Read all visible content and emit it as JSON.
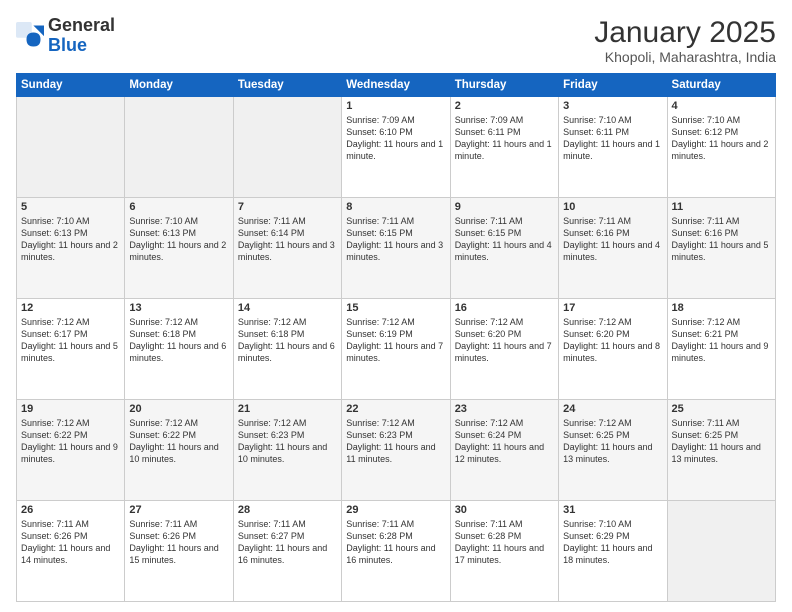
{
  "header": {
    "logo_general": "General",
    "logo_blue": "Blue",
    "month_title": "January 2025",
    "location": "Khopoli, Maharashtra, India"
  },
  "days_of_week": [
    "Sunday",
    "Monday",
    "Tuesday",
    "Wednesday",
    "Thursday",
    "Friday",
    "Saturday"
  ],
  "weeks": [
    [
      {
        "day": "",
        "sunrise": "",
        "sunset": "",
        "daylight": "",
        "empty": true
      },
      {
        "day": "",
        "sunrise": "",
        "sunset": "",
        "daylight": "",
        "empty": true
      },
      {
        "day": "",
        "sunrise": "",
        "sunset": "",
        "daylight": "",
        "empty": true
      },
      {
        "day": "1",
        "sunrise": "Sunrise: 7:09 AM",
        "sunset": "Sunset: 6:10 PM",
        "daylight": "Daylight: 11 hours and 1 minute."
      },
      {
        "day": "2",
        "sunrise": "Sunrise: 7:09 AM",
        "sunset": "Sunset: 6:11 PM",
        "daylight": "Daylight: 11 hours and 1 minute."
      },
      {
        "day": "3",
        "sunrise": "Sunrise: 7:10 AM",
        "sunset": "Sunset: 6:11 PM",
        "daylight": "Daylight: 11 hours and 1 minute."
      },
      {
        "day": "4",
        "sunrise": "Sunrise: 7:10 AM",
        "sunset": "Sunset: 6:12 PM",
        "daylight": "Daylight: 11 hours and 2 minutes."
      }
    ],
    [
      {
        "day": "5",
        "sunrise": "Sunrise: 7:10 AM",
        "sunset": "Sunset: 6:13 PM",
        "daylight": "Daylight: 11 hours and 2 minutes."
      },
      {
        "day": "6",
        "sunrise": "Sunrise: 7:10 AM",
        "sunset": "Sunset: 6:13 PM",
        "daylight": "Daylight: 11 hours and 2 minutes."
      },
      {
        "day": "7",
        "sunrise": "Sunrise: 7:11 AM",
        "sunset": "Sunset: 6:14 PM",
        "daylight": "Daylight: 11 hours and 3 minutes."
      },
      {
        "day": "8",
        "sunrise": "Sunrise: 7:11 AM",
        "sunset": "Sunset: 6:15 PM",
        "daylight": "Daylight: 11 hours and 3 minutes."
      },
      {
        "day": "9",
        "sunrise": "Sunrise: 7:11 AM",
        "sunset": "Sunset: 6:15 PM",
        "daylight": "Daylight: 11 hours and 4 minutes."
      },
      {
        "day": "10",
        "sunrise": "Sunrise: 7:11 AM",
        "sunset": "Sunset: 6:16 PM",
        "daylight": "Daylight: 11 hours and 4 minutes."
      },
      {
        "day": "11",
        "sunrise": "Sunrise: 7:11 AM",
        "sunset": "Sunset: 6:16 PM",
        "daylight": "Daylight: 11 hours and 5 minutes."
      }
    ],
    [
      {
        "day": "12",
        "sunrise": "Sunrise: 7:12 AM",
        "sunset": "Sunset: 6:17 PM",
        "daylight": "Daylight: 11 hours and 5 minutes."
      },
      {
        "day": "13",
        "sunrise": "Sunrise: 7:12 AM",
        "sunset": "Sunset: 6:18 PM",
        "daylight": "Daylight: 11 hours and 6 minutes."
      },
      {
        "day": "14",
        "sunrise": "Sunrise: 7:12 AM",
        "sunset": "Sunset: 6:18 PM",
        "daylight": "Daylight: 11 hours and 6 minutes."
      },
      {
        "day": "15",
        "sunrise": "Sunrise: 7:12 AM",
        "sunset": "Sunset: 6:19 PM",
        "daylight": "Daylight: 11 hours and 7 minutes."
      },
      {
        "day": "16",
        "sunrise": "Sunrise: 7:12 AM",
        "sunset": "Sunset: 6:20 PM",
        "daylight": "Daylight: 11 hours and 7 minutes."
      },
      {
        "day": "17",
        "sunrise": "Sunrise: 7:12 AM",
        "sunset": "Sunset: 6:20 PM",
        "daylight": "Daylight: 11 hours and 8 minutes."
      },
      {
        "day": "18",
        "sunrise": "Sunrise: 7:12 AM",
        "sunset": "Sunset: 6:21 PM",
        "daylight": "Daylight: 11 hours and 9 minutes."
      }
    ],
    [
      {
        "day": "19",
        "sunrise": "Sunrise: 7:12 AM",
        "sunset": "Sunset: 6:22 PM",
        "daylight": "Daylight: 11 hours and 9 minutes."
      },
      {
        "day": "20",
        "sunrise": "Sunrise: 7:12 AM",
        "sunset": "Sunset: 6:22 PM",
        "daylight": "Daylight: 11 hours and 10 minutes."
      },
      {
        "day": "21",
        "sunrise": "Sunrise: 7:12 AM",
        "sunset": "Sunset: 6:23 PM",
        "daylight": "Daylight: 11 hours and 10 minutes."
      },
      {
        "day": "22",
        "sunrise": "Sunrise: 7:12 AM",
        "sunset": "Sunset: 6:23 PM",
        "daylight": "Daylight: 11 hours and 11 minutes."
      },
      {
        "day": "23",
        "sunrise": "Sunrise: 7:12 AM",
        "sunset": "Sunset: 6:24 PM",
        "daylight": "Daylight: 11 hours and 12 minutes."
      },
      {
        "day": "24",
        "sunrise": "Sunrise: 7:12 AM",
        "sunset": "Sunset: 6:25 PM",
        "daylight": "Daylight: 11 hours and 13 minutes."
      },
      {
        "day": "25",
        "sunrise": "Sunrise: 7:11 AM",
        "sunset": "Sunset: 6:25 PM",
        "daylight": "Daylight: 11 hours and 13 minutes."
      }
    ],
    [
      {
        "day": "26",
        "sunrise": "Sunrise: 7:11 AM",
        "sunset": "Sunset: 6:26 PM",
        "daylight": "Daylight: 11 hours and 14 minutes."
      },
      {
        "day": "27",
        "sunrise": "Sunrise: 7:11 AM",
        "sunset": "Sunset: 6:26 PM",
        "daylight": "Daylight: 11 hours and 15 minutes."
      },
      {
        "day": "28",
        "sunrise": "Sunrise: 7:11 AM",
        "sunset": "Sunset: 6:27 PM",
        "daylight": "Daylight: 11 hours and 16 minutes."
      },
      {
        "day": "29",
        "sunrise": "Sunrise: 7:11 AM",
        "sunset": "Sunset: 6:28 PM",
        "daylight": "Daylight: 11 hours and 16 minutes."
      },
      {
        "day": "30",
        "sunrise": "Sunrise: 7:11 AM",
        "sunset": "Sunset: 6:28 PM",
        "daylight": "Daylight: 11 hours and 17 minutes."
      },
      {
        "day": "31",
        "sunrise": "Sunrise: 7:10 AM",
        "sunset": "Sunset: 6:29 PM",
        "daylight": "Daylight: 11 hours and 18 minutes."
      },
      {
        "day": "",
        "sunrise": "",
        "sunset": "",
        "daylight": "",
        "empty": true
      }
    ]
  ]
}
